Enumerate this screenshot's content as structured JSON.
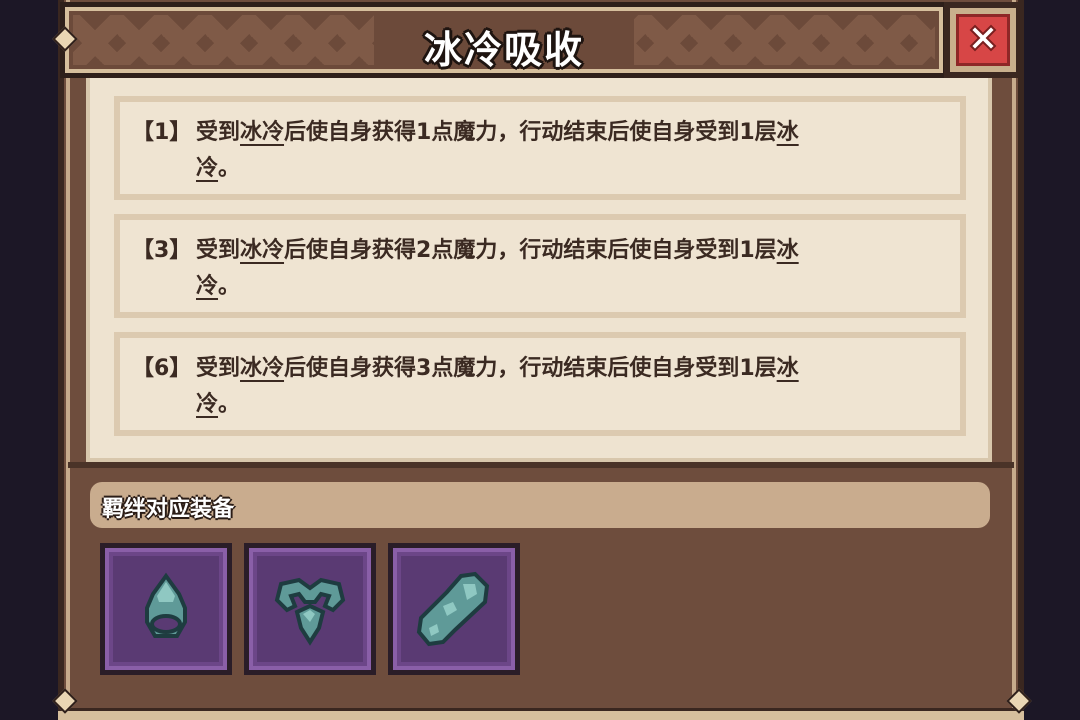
{
  "window": {
    "title": "冰冷吸收",
    "close_icon": "close-x-icon"
  },
  "effects": [
    {
      "tag": "【1】",
      "pre": "受到",
      "keyword": "冰冷",
      "mid": "后使自身获得1点魔力，行动结束后使自身受到1层",
      "keyword_end": "冰",
      "line2_keyword": "冷",
      "line2_suffix": "。"
    },
    {
      "tag": "【3】",
      "pre": "受到",
      "keyword": "冰冷",
      "mid": "后使自身获得2点魔力，行动结束后使自身受到1层",
      "keyword_end": "冰",
      "line2_keyword": "冷",
      "line2_suffix": "。"
    },
    {
      "tag": "【6】",
      "pre": "受到",
      "keyword": "冰冷",
      "mid": "后使自身获得3点魔力，行动结束后使自身受到1层",
      "keyword_end": "冰",
      "line2_keyword": "冷",
      "line2_suffix": "。"
    }
  ],
  "equipment_section": {
    "label": "羁绊对应装备",
    "items": [
      {
        "icon": "ice-ring-icon"
      },
      {
        "icon": "ice-necklace-icon"
      },
      {
        "icon": "ice-bracer-icon"
      }
    ]
  },
  "colors": {
    "panel": "#6e4d3d",
    "card_bg": "#efe4d2",
    "text": "#3b2a22",
    "slot_bg": "#5a3a73",
    "ice": "#5f9a98",
    "close_red": "#d74646"
  }
}
